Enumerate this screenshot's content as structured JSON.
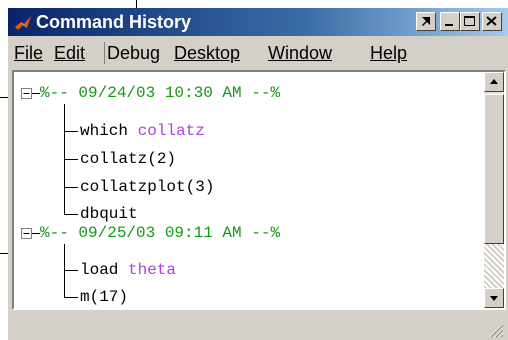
{
  "window": {
    "title": "Command History",
    "minimize_label": "Minimize",
    "restore_label": "Restore",
    "close_label": "Close",
    "undock_label": "Undock"
  },
  "menu": {
    "file": "File",
    "edit": "Edit",
    "debug": "Debug",
    "desktop": "Desktop",
    "window": "Window",
    "help": "Help"
  },
  "sessions": [
    {
      "stamp": "%-- 09/24/03 10:30 AM --%",
      "commands": [
        {
          "cmd": "which ",
          "arg": "collatz"
        },
        {
          "cmd": "collatz(2)",
          "arg": ""
        },
        {
          "cmd": "collatzplot(3)",
          "arg": ""
        },
        {
          "cmd": "dbquit",
          "arg": ""
        }
      ]
    },
    {
      "stamp": "%-- 09/25/03 09:11 AM --%",
      "commands": [
        {
          "cmd": "load ",
          "arg": "theta"
        },
        {
          "cmd": "m(17)",
          "arg": ""
        }
      ]
    }
  ],
  "colors": {
    "timestamp": "#119911",
    "keyword_arg": "#b040e0",
    "title_bar": "#0a246a"
  }
}
